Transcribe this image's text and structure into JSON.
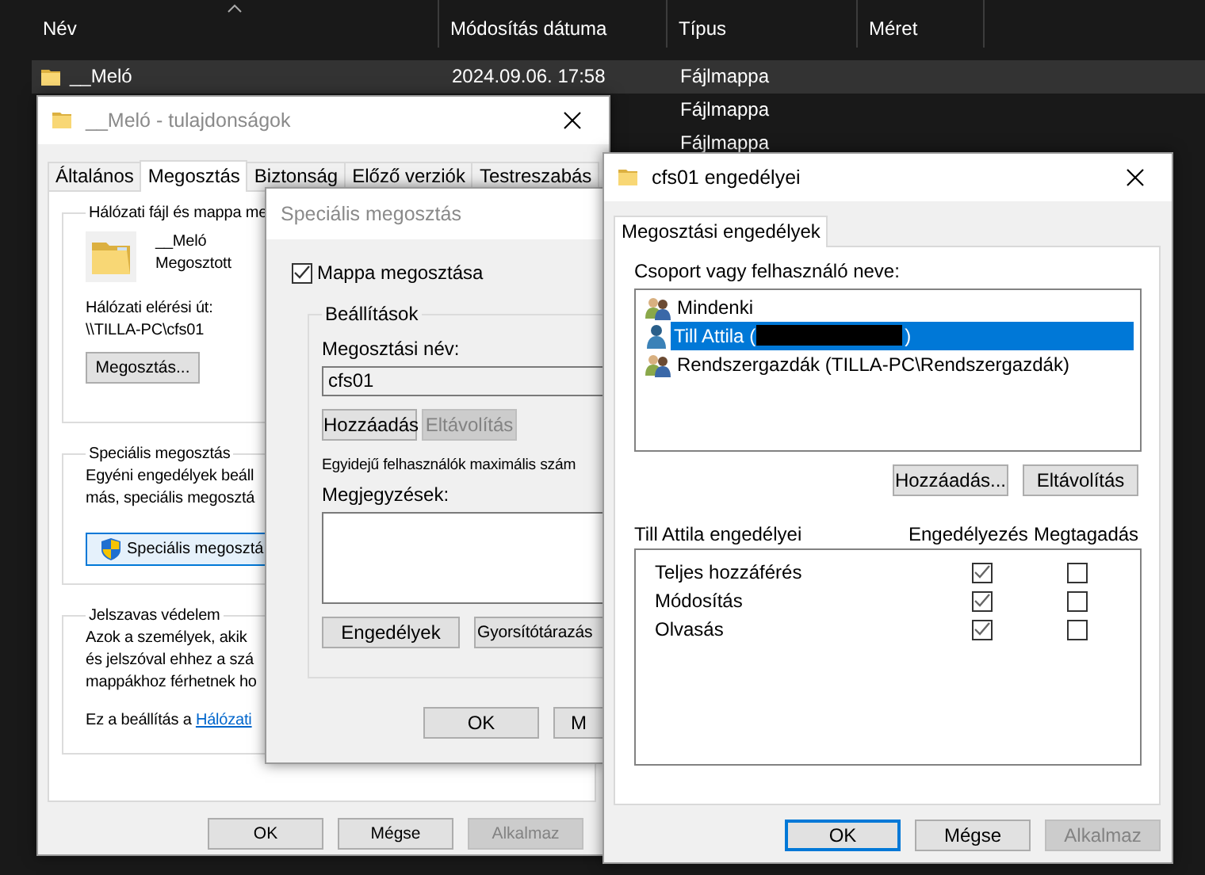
{
  "explorer": {
    "columns": [
      {
        "label": "Név",
        "sorted": true
      },
      {
        "label": "Módosítás dátuma",
        "sorted": false
      },
      {
        "label": "Típus",
        "sorted": false
      },
      {
        "label": "Méret",
        "sorted": false
      }
    ],
    "rows": [
      {
        "name": "__Meló",
        "modified": "2024.09.06. 17:58",
        "type": "Fájlmappa",
        "selected": true
      },
      {
        "type": "Fájlmappa",
        "selected": false
      },
      {
        "type": "Fájlmappa",
        "selected": false
      }
    ]
  },
  "properties_window": {
    "title": "__Meló - tulajdonságok",
    "active": false,
    "tabs": [
      {
        "label": "Általános",
        "selected": false
      },
      {
        "label": "Megosztás",
        "selected": true
      },
      {
        "label": "Biztonság",
        "selected": false
      },
      {
        "label": "Előző verziók",
        "selected": false
      },
      {
        "label": "Testreszabás",
        "selected": false
      }
    ],
    "network_sharing": {
      "title": "Hálózati fájl és mappa me",
      "folder_name": "__Meló",
      "status": "Megosztott",
      "path_label": "Hálózati elérési út:",
      "path": "\\\\TILLA-PC\\cfs01",
      "button": "Megosztás..."
    },
    "advanced_sharing": {
      "title": "Speciális megosztás",
      "lines": [
        "Egyéni engedélyek beáll",
        "más, speciális megosztá"
      ],
      "button": "Speciális megosztá"
    },
    "password_protection": {
      "title": "Jelszavas védelem",
      "lines": [
        "Azok a személyek, akik",
        "és jelszóval ehhez a szá",
        "mappákhoz férhetnek ho"
      ],
      "link_prefix": "Ez a beállítás a",
      "link": "Hálózati"
    },
    "buttons": [
      {
        "label": "OK",
        "disabled": false
      },
      {
        "label": "Mégse",
        "disabled": false
      },
      {
        "label": "Alkalmaz",
        "disabled": true
      }
    ]
  },
  "advanced_sharing_window": {
    "title": "Speciális megosztás",
    "active": false,
    "share_checkbox": {
      "label": "Mappa megosztása",
      "checked": true
    },
    "settings": {
      "title": "Beállítások",
      "name_label": "Megosztási név:",
      "share_name": "cfs01",
      "name_buttons": [
        {
          "label": "Hozzáadás",
          "disabled": false
        },
        {
          "label": "Eltávolítás",
          "disabled": true
        }
      ],
      "max_users_label": "Egyidejű felhasználók maximális szám",
      "comments_label": "Megjegyzések:",
      "action_buttons": [
        {
          "label": "Engedélyek",
          "disabled": false
        },
        {
          "label": "Gyorsítótárazás",
          "disabled": false
        }
      ]
    },
    "buttons": [
      {
        "label": "OK",
        "disabled": false
      },
      {
        "label": "M",
        "disabled": false
      }
    ]
  },
  "permissions_window": {
    "title": "cfs01 engedélyei",
    "active": true,
    "tabs": [
      {
        "label": "Megosztási engedélyek",
        "selected": true
      }
    ],
    "list_label": "Csoport vagy felhasználó neve:",
    "principals": [
      {
        "kind": "group",
        "label": "Mindenki",
        "redacted": false,
        "selected": false
      },
      {
        "kind": "user",
        "label": "Till Attila (",
        "redacted": true,
        "suffix": ")",
        "selected": true
      },
      {
        "kind": "group",
        "label": "Rendszergazdák (TILLA-PC\\Rendszergazdák)",
        "redacted": false,
        "selected": false
      }
    ],
    "list_buttons": [
      {
        "label": "Hozzáadás...",
        "disabled": false
      },
      {
        "label": "Eltávolítás",
        "disabled": false
      }
    ],
    "permissions_label": "Till Attila engedélyei",
    "allow_header": "Engedélyezés",
    "deny_header": "Megtagadás",
    "permissions": [
      {
        "label": "Teljes hozzáférés",
        "allow": true,
        "deny": false
      },
      {
        "label": "Módosítás",
        "allow": true,
        "deny": false
      },
      {
        "label": "Olvasás",
        "allow": true,
        "deny": false
      }
    ],
    "buttons": [
      {
        "label": "OK",
        "default": true,
        "disabled": false
      },
      {
        "label": "Mégse",
        "default": false,
        "disabled": false
      },
      {
        "label": "Alkalmaz",
        "default": false,
        "disabled": true
      }
    ]
  }
}
